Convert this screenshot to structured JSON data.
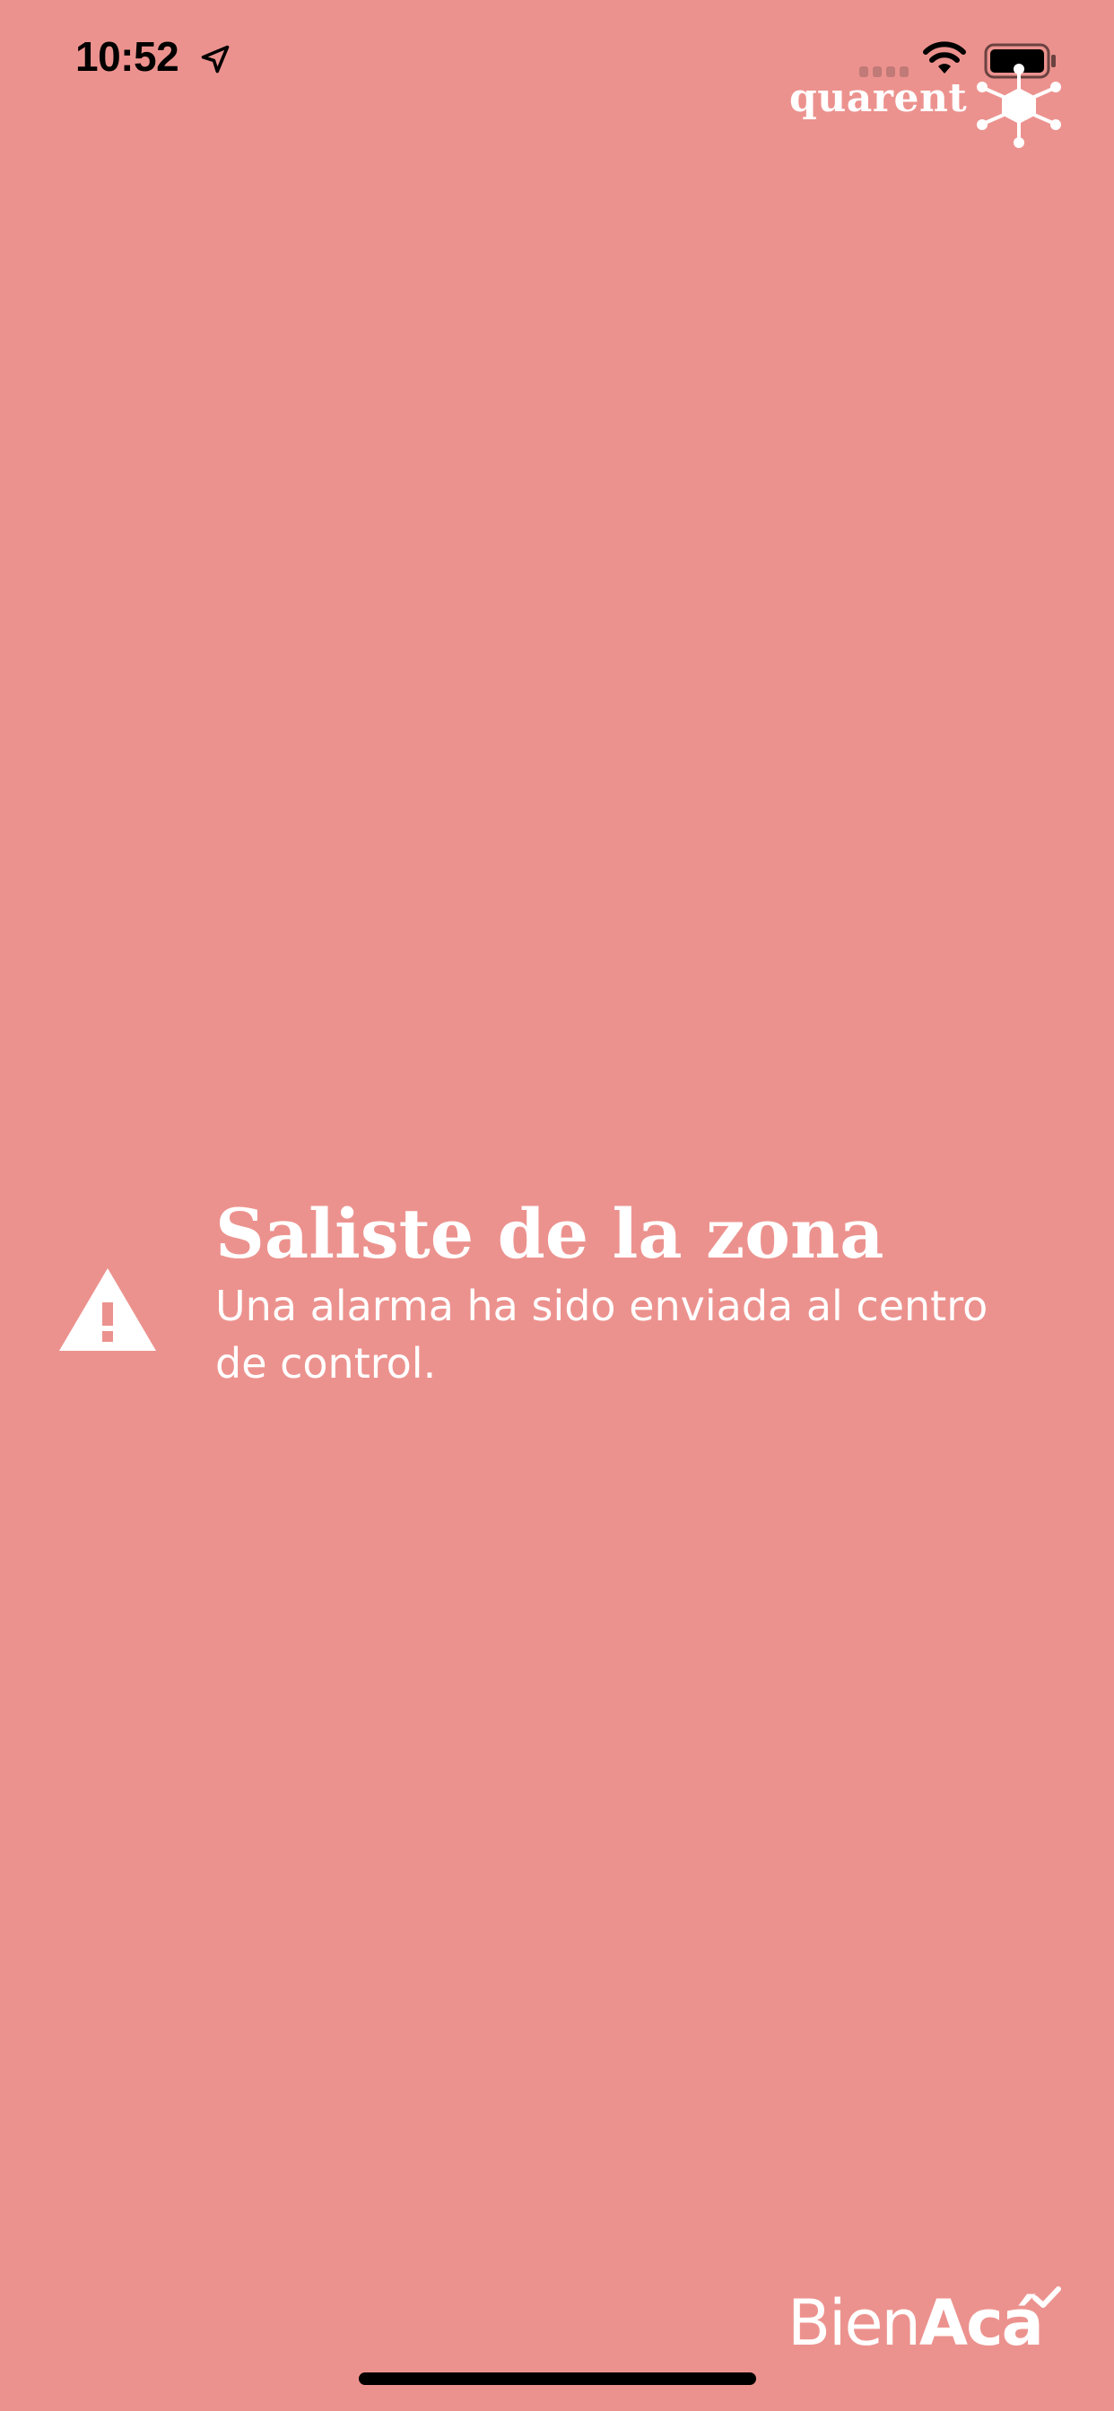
{
  "status_bar": {
    "time": "10:52",
    "icons": [
      "location-arrow-icon",
      "cellular-signal-icon",
      "wifi-icon",
      "battery-icon"
    ]
  },
  "brand": {
    "name": "quarent",
    "logo_icon": "hexagon-network-icon"
  },
  "alert": {
    "icon": "warning-icon",
    "title": "Saliste de la zona",
    "message": "Una alarma ha sido enviada al centro de control."
  },
  "footer": {
    "brand_light": "Bien",
    "brand_bold": "Acá",
    "check_icon": "check-icon"
  },
  "colors": {
    "background": "#EC928E",
    "foreground": "#FFFFFF",
    "status_text": "#000000"
  }
}
